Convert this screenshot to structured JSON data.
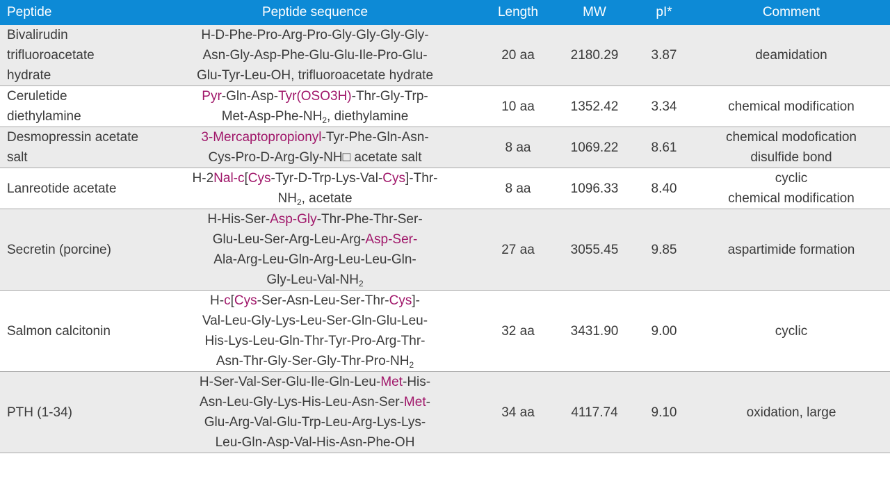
{
  "colors": {
    "header_bg": "#0d8ad6",
    "row_alt_bg": "#ebebeb",
    "modification_text": "#a0176a"
  },
  "columns": [
    "Peptide",
    "Peptide sequence",
    "Length",
    "MW",
    "pI*",
    "Comment"
  ],
  "rows": [
    {
      "peptide": "Bivalirudin trifluoroacetate hydrate",
      "sequence_lines": [
        [
          {
            "t": "H-D-Phe-Pro-Arg-Pro-Gly-Gly-Gly-Gly-"
          }
        ],
        [
          {
            "t": "Asn-Gly-Asp-Phe-Glu-Glu-Ile-Pro-Glu-"
          }
        ],
        [
          {
            "t": "Glu-Tyr-Leu-OH, trifluoroacetate hydrate"
          }
        ]
      ],
      "length": "20 aa",
      "mw": "2180.29",
      "pi": "3.87",
      "comment_lines": [
        "deamidation"
      ]
    },
    {
      "peptide": "Ceruletide diethylamine",
      "sequence_lines": [
        [
          {
            "t": "Pyr",
            "mod": true
          },
          {
            "t": "-Gln-Asp-"
          },
          {
            "t": "Tyr(OSO3H)",
            "mod": true
          },
          {
            "t": "-Thr-Gly-Trp-"
          }
        ],
        [
          {
            "t": "Met-Asp-Phe-NH"
          },
          {
            "t": "2",
            "sub": true
          },
          {
            "t": ", diethylamine"
          }
        ]
      ],
      "length": "10 aa",
      "mw": "1352.42",
      "pi": "3.34",
      "comment_lines": [
        "chemical modification"
      ]
    },
    {
      "peptide": "Desmopressin acetate salt",
      "sequence_lines": [
        [
          {
            "t": "3-Mercaptopropionyl",
            "mod": true
          },
          {
            "t": "-Tyr-Phe-Gln-Asn-"
          }
        ],
        [
          {
            "t": "Cys-Pro-D-Arg-Gly-NH□ acetate salt"
          }
        ]
      ],
      "length": "8 aa",
      "mw": "1069.22",
      "pi": "8.61",
      "comment_lines": [
        "chemical modofication",
        "disulfide bond"
      ]
    },
    {
      "peptide": "Lanreotide acetate",
      "sequence_lines": [
        [
          {
            "t": "H-2"
          },
          {
            "t": "Nal-c",
            "mod": true
          },
          {
            "t": "["
          },
          {
            "t": "Cys",
            "mod": true
          },
          {
            "t": "-Tyr-D-Trp-Lys-Val-"
          },
          {
            "t": "Cys",
            "mod": true
          },
          {
            "t": "]-Thr-"
          }
        ],
        [
          {
            "t": "NH"
          },
          {
            "t": "2",
            "sub": true
          },
          {
            "t": ", acetate"
          }
        ]
      ],
      "length": "8 aa",
      "mw": "1096.33",
      "pi": "8.40",
      "comment_lines": [
        "cyclic",
        "chemical modification"
      ]
    },
    {
      "peptide": "Secretin (porcine)",
      "sequence_lines": [
        [
          {
            "t": "H-His-Ser-"
          },
          {
            "t": "Asp-Gly",
            "mod": true
          },
          {
            "t": "-Thr-Phe-Thr-Ser-"
          }
        ],
        [
          {
            "t": "Glu-Leu-Ser-Arg-Leu-Arg-"
          },
          {
            "t": "Asp-Ser-",
            "mod": true
          }
        ],
        [
          {
            "t": "Ala-Arg-Leu-Gln-Arg-Leu-Leu-Gln-"
          }
        ],
        [
          {
            "t": "Gly-Leu-Val-NH"
          },
          {
            "t": "2",
            "sub": true
          }
        ]
      ],
      "length": "27 aa",
      "mw": "3055.45",
      "pi": "9.85",
      "comment_lines": [
        "aspartimide formation"
      ]
    },
    {
      "peptide": "Salmon calcitonin",
      "sequence_lines": [
        [
          {
            "t": "H-"
          },
          {
            "t": "c",
            "mod": true
          },
          {
            "t": "["
          },
          {
            "t": "Cys",
            "mod": true
          },
          {
            "t": "-Ser-Asn-Leu-Ser-Thr-"
          },
          {
            "t": "Cys",
            "mod": true
          },
          {
            "t": "]-"
          }
        ],
        [
          {
            "t": "Val-Leu-Gly-Lys-Leu-Ser-Gln-Glu-Leu-"
          }
        ],
        [
          {
            "t": "His-Lys-Leu-Gln-Thr-Tyr-Pro-Arg-Thr-"
          }
        ],
        [
          {
            "t": "Asn-Thr-Gly-Ser-Gly-Thr-Pro-NH"
          },
          {
            "t": "2",
            "sub": true
          }
        ]
      ],
      "length": "32 aa",
      "mw": "3431.90",
      "pi": "9.00",
      "comment_lines": [
        "cyclic"
      ]
    },
    {
      "peptide": "PTH (1-34)",
      "sequence_lines": [
        [
          {
            "t": "H-Ser-Val-Ser-Glu-Ile-Gln-Leu-"
          },
          {
            "t": "Met",
            "mod": true
          },
          {
            "t": "-His-"
          }
        ],
        [
          {
            "t": "Asn-Leu-Gly-Lys-His-Leu-Asn-Ser-"
          },
          {
            "t": "Met",
            "mod": true
          },
          {
            "t": "-"
          }
        ],
        [
          {
            "t": "Glu-Arg-Val-Glu-Trp-Leu-Arg-Lys-Lys-"
          }
        ],
        [
          {
            "t": "Leu-Gln-Asp-Val-His-Asn-Phe-OH"
          }
        ]
      ],
      "length": "34 aa",
      "mw": "4117.74",
      "pi": "9.10",
      "comment_lines": [
        "oxidation, large"
      ]
    }
  ]
}
